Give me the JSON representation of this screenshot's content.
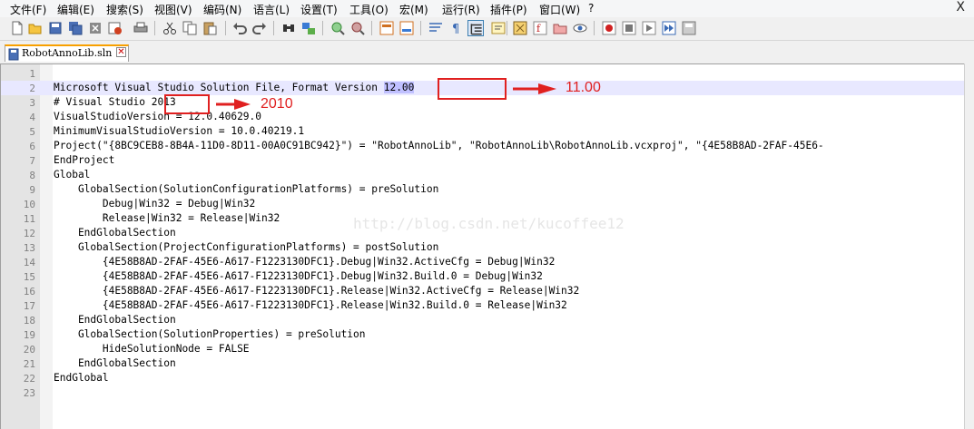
{
  "menu": {
    "items": [
      "文件(F)",
      "编辑(E)",
      "搜索(S)",
      "视图(V)",
      "编码(N)",
      "语言(L)",
      "设置(T)",
      "工具(O)",
      "宏(M)",
      "运行(R)",
      "插件(P)",
      "窗口(W)",
      "?"
    ],
    "close": "X"
  },
  "toolbar": {
    "icons": [
      "new-file-icon",
      "open-file-icon",
      "save-icon",
      "save-all-icon",
      "close-icon",
      "close-all-icon",
      "print-icon",
      "cut-icon",
      "copy-icon",
      "paste-icon",
      "undo-icon",
      "redo-icon",
      "find-icon",
      "replace-icon",
      "zoom-in-icon",
      "zoom-out-icon",
      "sync-vertical-icon",
      "sync-horizontal-icon",
      "word-wrap-icon",
      "show-all-chars-icon",
      "indent-guide-icon",
      "user-lang-icon",
      "doc-map-icon",
      "function-list-icon",
      "folder-workspace-icon",
      "monitor-icon",
      "record-macro-icon",
      "stop-record-icon",
      "play-macro-icon",
      "run-macro-multiple-icon",
      "save-macro-icon"
    ]
  },
  "tab": {
    "label": "RobotAnnoLib.sln"
  },
  "editor": {
    "lines": [
      {
        "n": "1",
        "text": ""
      },
      {
        "n": "2",
        "text": "Microsoft Visual Studio Solution File, Format Version ",
        "sel": "12.00"
      },
      {
        "n": "3",
        "text": "# Visual Studio 2013"
      },
      {
        "n": "4",
        "text": "VisualStudioVersion = 12.0.40629.0"
      },
      {
        "n": "5",
        "text": "MinimumVisualStudioVersion = 10.0.40219.1"
      },
      {
        "n": "6",
        "text": "Project(\"{8BC9CEB8-8B4A-11D0-8D11-00A0C91BC942}\") = \"RobotAnnoLib\", \"RobotAnnoLib\\RobotAnnoLib.vcxproj\", \"{4E58B8AD-2FAF-45E6-"
      },
      {
        "n": "7",
        "text": "EndProject"
      },
      {
        "n": "8",
        "text": "Global"
      },
      {
        "n": "9",
        "text": "    GlobalSection(SolutionConfigurationPlatforms) = preSolution"
      },
      {
        "n": "10",
        "text": "        Debug|Win32 = Debug|Win32"
      },
      {
        "n": "11",
        "text": "        Release|Win32 = Release|Win32"
      },
      {
        "n": "12",
        "text": "    EndGlobalSection"
      },
      {
        "n": "13",
        "text": "    GlobalSection(ProjectConfigurationPlatforms) = postSolution"
      },
      {
        "n": "14",
        "text": "        {4E58B8AD-2FAF-45E6-A617-F1223130DFC1}.Debug|Win32.ActiveCfg = Debug|Win32"
      },
      {
        "n": "15",
        "text": "        {4E58B8AD-2FAF-45E6-A617-F1223130DFC1}.Debug|Win32.Build.0 = Debug|Win32"
      },
      {
        "n": "16",
        "text": "        {4E58B8AD-2FAF-45E6-A617-F1223130DFC1}.Release|Win32.ActiveCfg = Release|Win32"
      },
      {
        "n": "17",
        "text": "        {4E58B8AD-2FAF-45E6-A617-F1223130DFC1}.Release|Win32.Build.0 = Release|Win32"
      },
      {
        "n": "18",
        "text": "    EndGlobalSection"
      },
      {
        "n": "19",
        "text": "    GlobalSection(SolutionProperties) = preSolution"
      },
      {
        "n": "20",
        "text": "        HideSolutionNode = FALSE"
      },
      {
        "n": "21",
        "text": "    EndGlobalSection"
      },
      {
        "n": "22",
        "text": "EndGlobal"
      },
      {
        "n": "23",
        "text": ""
      }
    ],
    "current_line": "2",
    "watermark": "http://blog.csdn.net/kucoffee12"
  },
  "annotations": {
    "version_new": "11.00",
    "vs_new": "2010",
    "color": "#e02020"
  },
  "colors": {
    "tab_accent": "#f8a000",
    "current_line_bg": "#e8e8ff",
    "selection_bg": "#c0c0ff"
  }
}
